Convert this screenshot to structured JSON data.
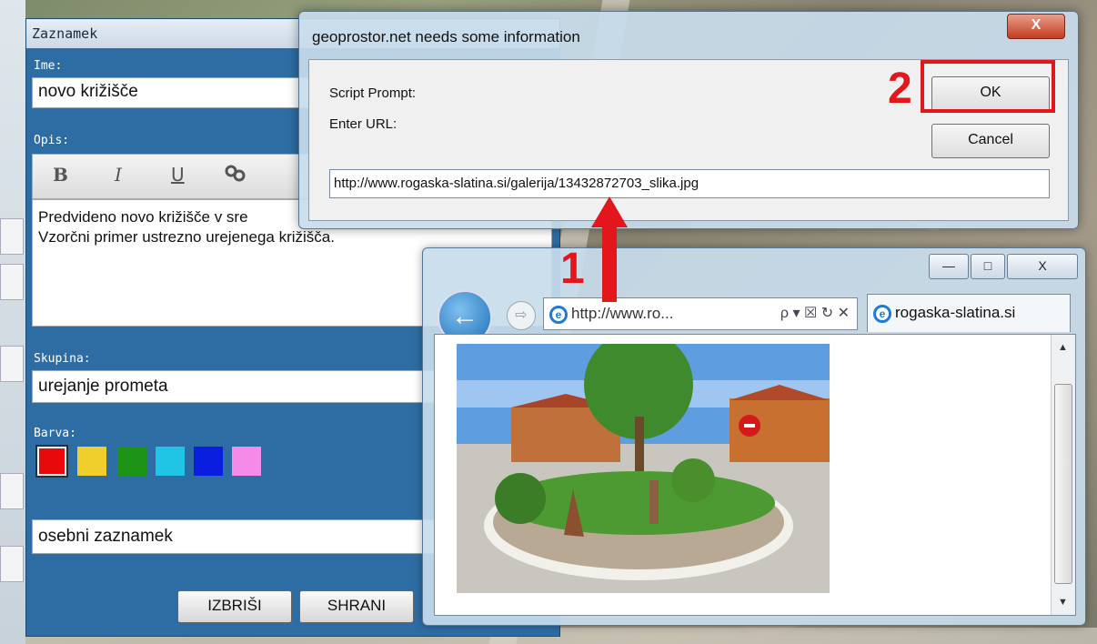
{
  "panel": {
    "title": "Zaznamek",
    "name_label": "Ime:",
    "name_value": "novo križišče",
    "desc_label": "Opis:",
    "toolbar": {
      "bold": "B",
      "italic": "I",
      "underline": "U",
      "link_icon": "link-icon"
    },
    "desc_text_line1": "Predvideno novo križišče v sre",
    "desc_text_line2": "Vzorčni primer ustrezno urejenega križišča.",
    "group_label": "Skupina:",
    "group_value": "urejanje prometa",
    "color_label": "Barva:",
    "colors": [
      "#e8090c",
      "#f0cf2c",
      "#1e9417",
      "#20c4e4",
      "#0a1ee0",
      "#f58ae8"
    ],
    "type_value": "osebni zaznamek",
    "delete_label": "IZBRIŠI",
    "save_label": "SHRANI"
  },
  "dialog": {
    "title": "geoprostor.net needs some information",
    "close": "X",
    "script_prompt": "Script Prompt:",
    "enter_url": "Enter URL:",
    "ok": "OK",
    "cancel": "Cancel",
    "url_value": "http://www.rogaska-slatina.si/galerija/13432872703_slika.jpg"
  },
  "browser": {
    "minimize": "—",
    "maximize": "□",
    "close": "X",
    "address": "http://www.ro...",
    "address_icons": "ρ ▾ ☒ ↻ ✕",
    "tab_title": "rogaska-slatina.si"
  },
  "annotations": {
    "step1": "1",
    "step2": "2"
  },
  "accent": {
    "red": "#e2161b",
    "panel_blue": "#2e6da4"
  }
}
